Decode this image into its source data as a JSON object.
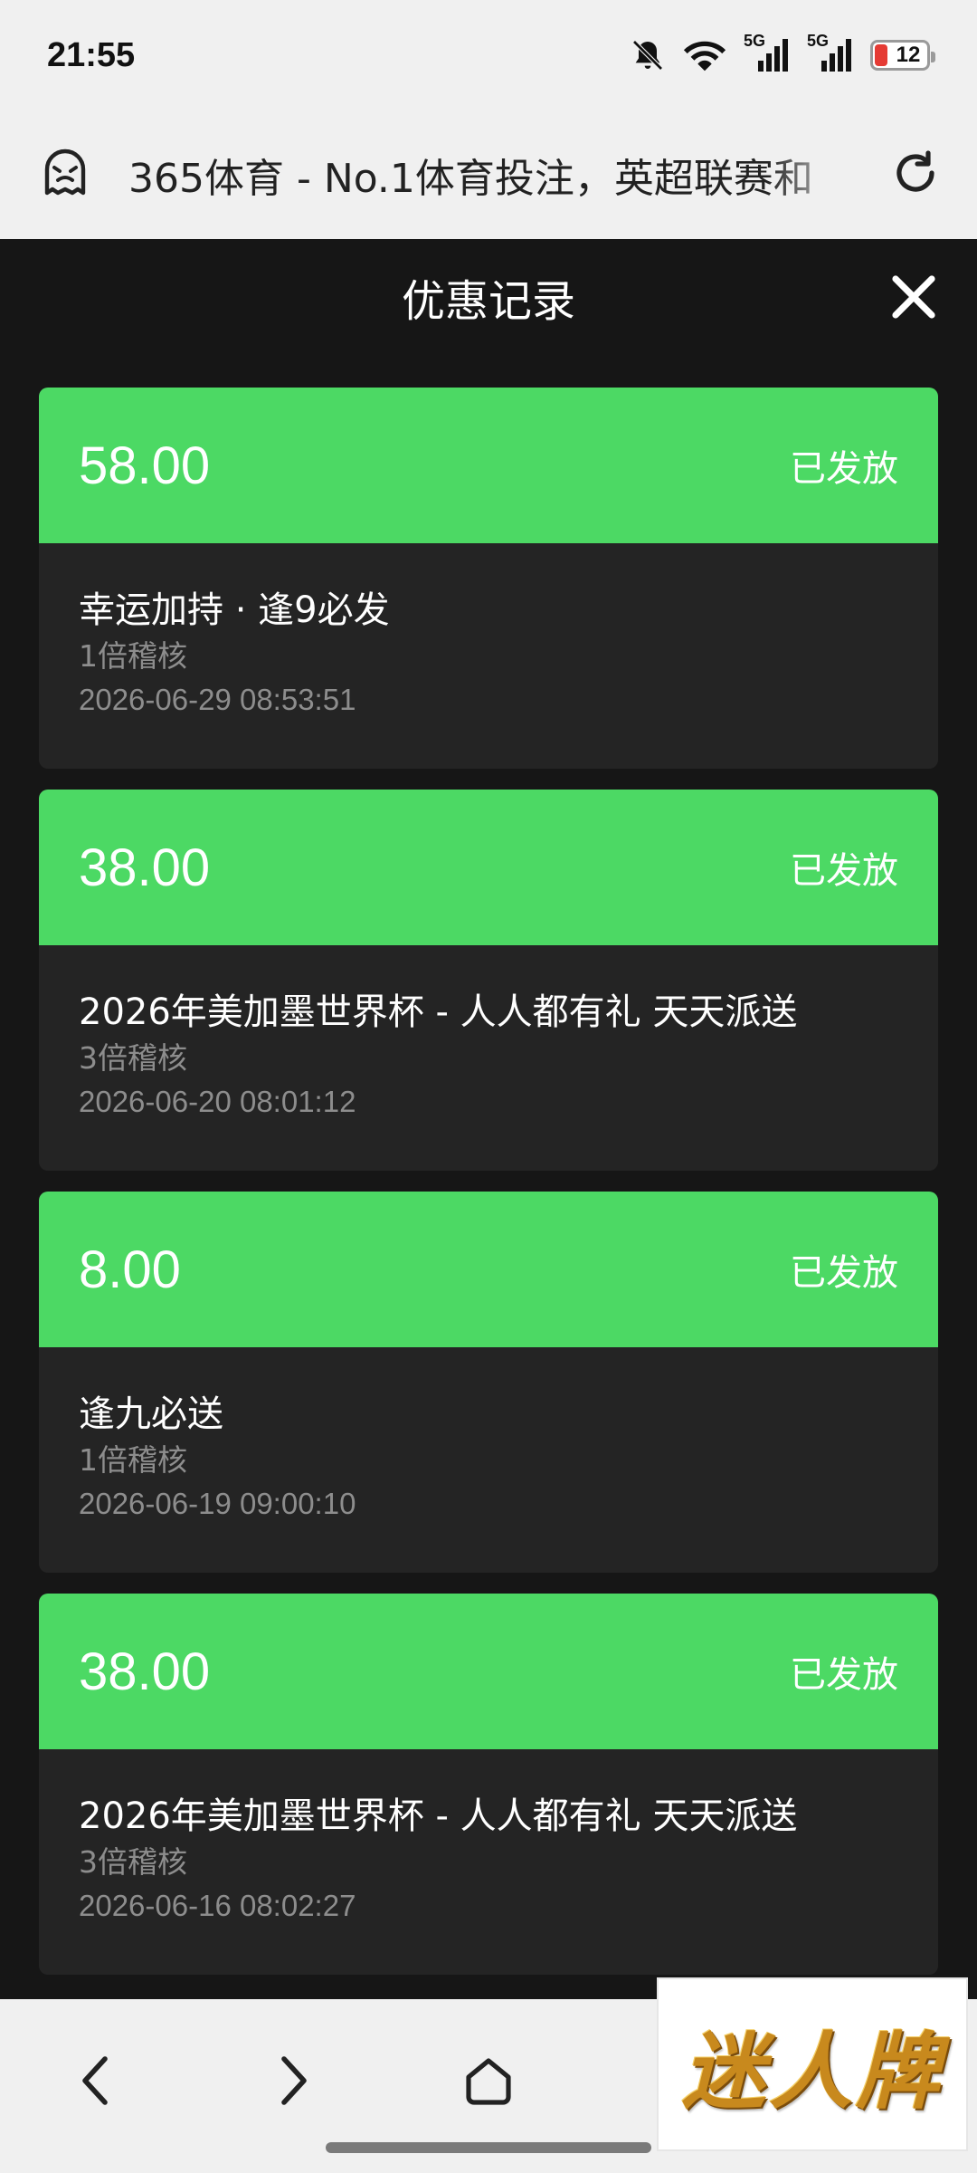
{
  "status_bar": {
    "time": "21:55",
    "network_label_1": "5G",
    "network_label_2": "5G",
    "battery_level": "12",
    "battery_color": "#e53b34"
  },
  "browser": {
    "page_title": "365体育 - No.1体育投注，英超联赛和"
  },
  "modal": {
    "title": "优惠记录"
  },
  "colors": {
    "card_header": "#4cd964",
    "card_body": "#242424",
    "background": "#161616"
  },
  "records": [
    {
      "amount": "58.00",
      "status": "已发放",
      "name": "幸运加持 · 逢9必发",
      "wager": "1倍稽核",
      "datetime": "2026-06-29 08:53:51"
    },
    {
      "amount": "38.00",
      "status": "已发放",
      "name": "2026年美加墨世界杯  -  人人都有礼 天天派送",
      "wager": "3倍稽核",
      "datetime": "2026-06-20 08:01:12"
    },
    {
      "amount": "8.00",
      "status": "已发放",
      "name": "逢九必送",
      "wager": "1倍稽核",
      "datetime": "2026-06-19 09:00:10"
    },
    {
      "amount": "38.00",
      "status": "已发放",
      "name": "2026年美加墨世界杯  -  人人都有礼 天天派送",
      "wager": "3倍稽核",
      "datetime": "2026-06-16 08:02:27"
    }
  ],
  "watermark": {
    "text": "迷人牌"
  },
  "icons": {
    "site": "ghost-face-icon",
    "reload": "reload-icon",
    "close": "close-icon",
    "back": "chevron-left-icon",
    "forward": "chevron-right-icon",
    "home": "home-icon"
  }
}
